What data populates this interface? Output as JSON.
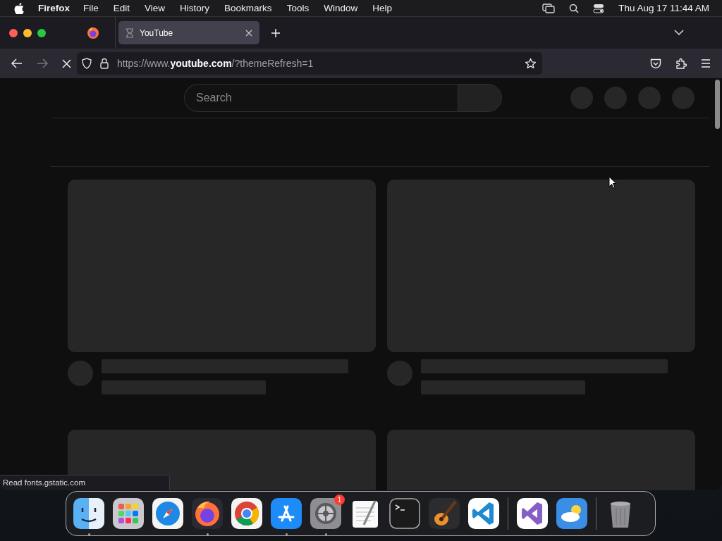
{
  "menu_bar": {
    "app_name": "Firefox",
    "items": [
      "File",
      "Edit",
      "View",
      "History",
      "Bookmarks",
      "Tools",
      "Window",
      "Help"
    ],
    "clock": "Thu Aug 17  11:44 AM"
  },
  "tabs": [
    {
      "title": "YouTube",
      "selected": true,
      "loading": true
    }
  ],
  "address_bar": {
    "url": "https://www.**youtube.com**/?themeRefresh=1"
  },
  "page": {
    "search": {
      "placeholder": "Search"
    },
    "loading": true
  },
  "status_bar": {
    "text": "Read fonts.gstatic.com"
  },
  "dock": {
    "groups": [
      [
        {
          "kind": "finder",
          "running": true
        },
        {
          "kind": "launchpad",
          "running": false
        },
        {
          "kind": "safari",
          "running": false
        },
        {
          "kind": "firefox",
          "running": true
        },
        {
          "kind": "chrome",
          "running": false
        },
        {
          "kind": "appstore",
          "running": true
        },
        {
          "kind": "settings",
          "running": true,
          "badge": "1"
        },
        {
          "kind": "textedit",
          "running": false
        },
        {
          "kind": "terminal",
          "running": false
        },
        {
          "kind": "garageband",
          "running": false
        },
        {
          "kind": "vscode",
          "running": false
        }
      ],
      [
        {
          "kind": "visualstudio",
          "running": false
        },
        {
          "kind": "weather",
          "running": false
        }
      ],
      [
        {
          "kind": "trash",
          "running": false
        }
      ]
    ]
  }
}
